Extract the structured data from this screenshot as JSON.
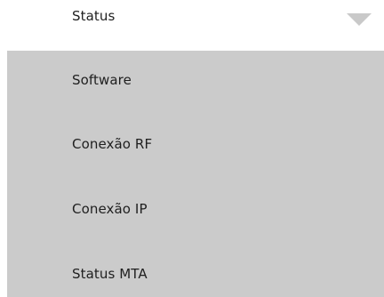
{
  "dropdown": {
    "selected_label": "Status",
    "toggle_icon": "chevron-down-icon",
    "colors": {
      "header_background": "#ffffff",
      "menu_background": "#cbcbcb",
      "chevron": "#c9c9c9",
      "text": "#1f1f1f"
    },
    "items": [
      {
        "label": "Software"
      },
      {
        "label": "Conexão RF"
      },
      {
        "label": "Conexão IP"
      },
      {
        "label": "Status MTA"
      }
    ]
  }
}
